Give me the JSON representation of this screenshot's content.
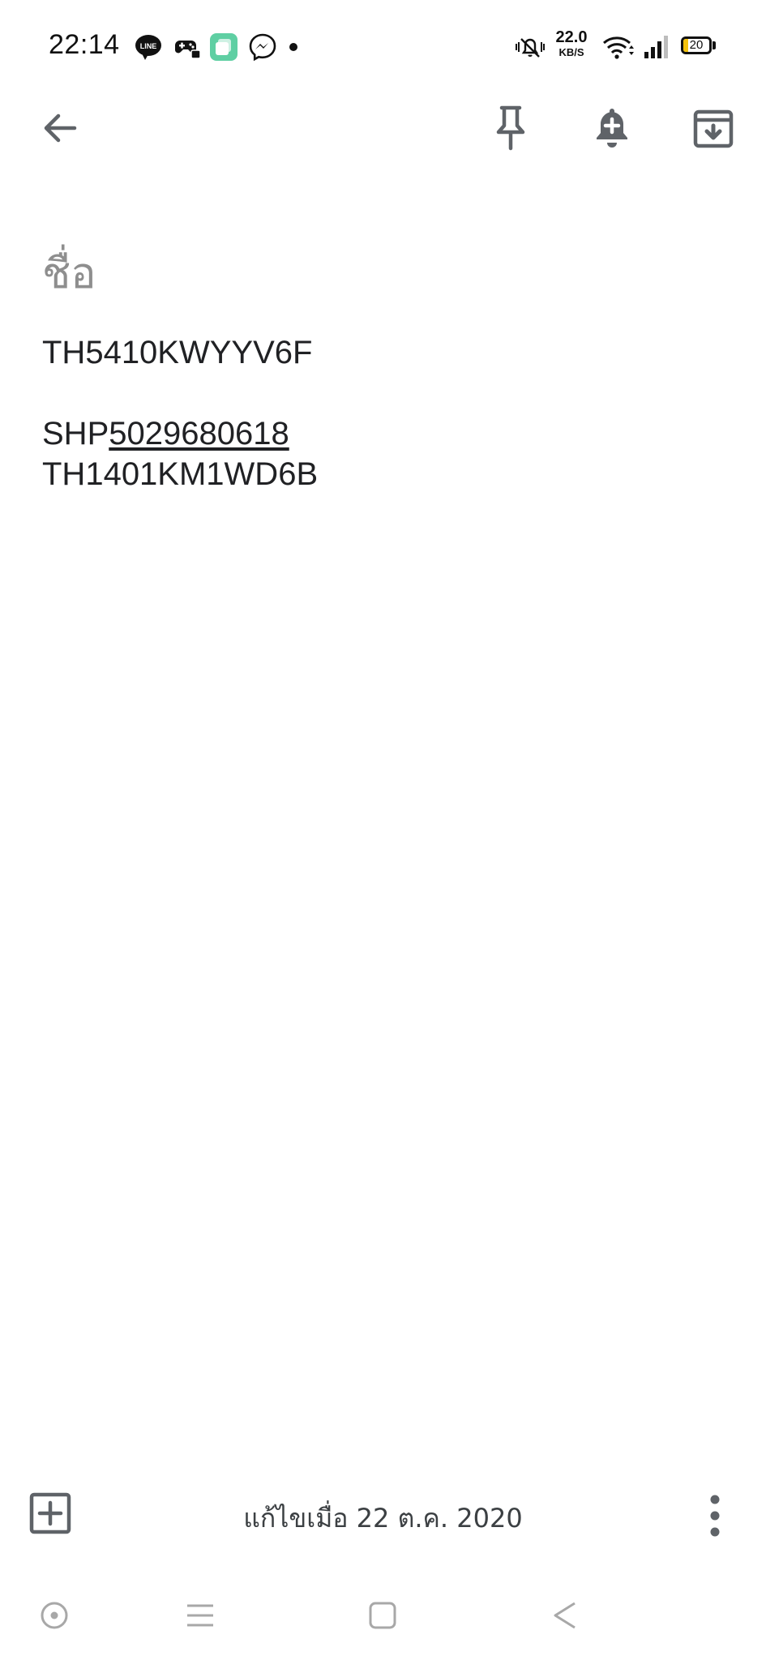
{
  "status_bar": {
    "time": "22:14",
    "net_speed_value": "22.0",
    "net_speed_unit": "KB/S",
    "battery_level": "20",
    "battery_fraction": 0.2,
    "notification_icons": [
      "line-icon",
      "game-controller-icon",
      "multitask-app-icon",
      "messenger-icon",
      "more-dot-icon"
    ],
    "system_icons": [
      "vibrate-mute-icon",
      "wifi-icon",
      "cell-signal-icon",
      "battery-icon"
    ]
  },
  "toolbar": {
    "back": "back-arrow-icon",
    "actions": [
      "pin-icon",
      "reminder-bell-icon",
      "archive-icon"
    ]
  },
  "note": {
    "title_placeholder": "ชื่อ",
    "line1": "TH5410KWYYV6F",
    "line2_prefix": "SHP",
    "line2_link": "5029680618",
    "line3": "TH1401KM1WD6B"
  },
  "bottom_bar": {
    "edited_label": "แก้ไขเมื่อ 22 ต.ค. 2020"
  },
  "colors": {
    "text": "#202124",
    "icon_gray": "#5f6368",
    "placeholder": "#8e8e8e",
    "battery_fill": "#f4c20d",
    "app_icon_green": "#5fcfa3"
  }
}
